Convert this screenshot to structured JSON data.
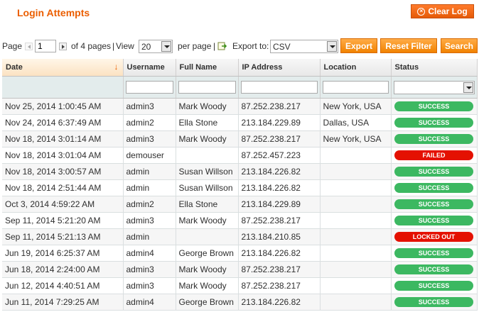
{
  "header": {
    "title": "Login Attempts",
    "clear_log": "Clear Log"
  },
  "pager": {
    "page_label": "Page",
    "page_value": "1",
    "of_pages": "of 4 pages",
    "view_label": "View",
    "per_page_value": "20",
    "per_page_label": "per page",
    "export_label": "Export to:",
    "export_format": "CSV"
  },
  "actions": {
    "export": "Export",
    "reset_filter": "Reset Filter",
    "search": "Search"
  },
  "columns": [
    "Date",
    "Username",
    "Full Name",
    "IP Address",
    "Location",
    "Status"
  ],
  "rows": [
    {
      "date": "Nov 25, 2014 1:00:45 AM",
      "username": "admin3",
      "full_name": "Mark Woody",
      "ip": "87.252.238.217",
      "location": "New York, USA",
      "status": "SUCCESS"
    },
    {
      "date": "Nov 24, 2014 6:37:49 AM",
      "username": "admin2",
      "full_name": "Ella Stone",
      "ip": "213.184.229.89",
      "location": "Dallas, USA",
      "status": "SUCCESS"
    },
    {
      "date": "Nov 18, 2014 3:01:14 AM",
      "username": "admin3",
      "full_name": "Mark Woody",
      "ip": "87.252.238.217",
      "location": "New York, USA",
      "status": "SUCCESS"
    },
    {
      "date": "Nov 18, 2014 3:01:04 AM",
      "username": "demouser",
      "full_name": "",
      "ip": "87.252.457.223",
      "location": "",
      "status": "FAILED"
    },
    {
      "date": "Nov 18, 2014 3:00:57 AM",
      "username": "admin",
      "full_name": "Susan Willson",
      "ip": "213.184.226.82",
      "location": "",
      "status": "SUCCESS"
    },
    {
      "date": "Nov 18, 2014 2:51:44 AM",
      "username": "admin",
      "full_name": "Susan Willson",
      "ip": "213.184.226.82",
      "location": "",
      "status": "SUCCESS"
    },
    {
      "date": "Oct 3, 2014 4:59:22 AM",
      "username": "admin2",
      "full_name": "Ella Stone",
      "ip": "213.184.229.89",
      "location": "",
      "status": "SUCCESS"
    },
    {
      "date": "Sep 11, 2014 5:21:20 AM",
      "username": "admin3",
      "full_name": "Mark Woody",
      "ip": "87.252.238.217",
      "location": "",
      "status": "SUCCESS"
    },
    {
      "date": "Sep 11, 2014 5:21:13 AM",
      "username": "admin",
      "full_name": "",
      "ip": "213.184.210.85",
      "location": "",
      "status": "LOCKED OUT"
    },
    {
      "date": "Jun 19, 2014 6:25:37 AM",
      "username": "admin4",
      "full_name": "George Brown",
      "ip": "213.184.226.82",
      "location": "",
      "status": "SUCCESS"
    },
    {
      "date": "Jun 18, 2014 2:24:00 AM",
      "username": "admin3",
      "full_name": "Mark Woody",
      "ip": "87.252.238.217",
      "location": "",
      "status": "SUCCESS"
    },
    {
      "date": "Jun 12, 2014 4:40:51 AM",
      "username": "admin3",
      "full_name": "Mark Woody",
      "ip": "87.252.238.217",
      "location": "",
      "status": "SUCCESS"
    },
    {
      "date": "Jun 11, 2014 7:29:25 AM",
      "username": "admin4",
      "full_name": "George Brown",
      "ip": "213.184.226.82",
      "location": "",
      "status": "SUCCESS"
    }
  ]
}
